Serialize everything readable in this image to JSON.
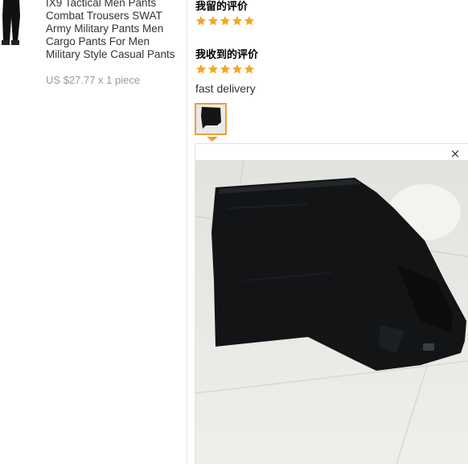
{
  "product": {
    "title": "IX9 Tactical Men Pants Combat Trousers SWAT Army Military Pants Men Cargo Pants For Men Military Style Casual Pants",
    "price": "US $27.77 x 1 piece",
    "thumbnail_icon": "black-pants-thumbnail"
  },
  "feedback": {
    "my_review_title": "我留的评价",
    "my_rating": 5,
    "received_review_title": "我收到的评价",
    "received_rating": 5,
    "review_text": "fast delivery",
    "star_color": "#f5a623"
  },
  "preview": {
    "close_label": "×"
  }
}
